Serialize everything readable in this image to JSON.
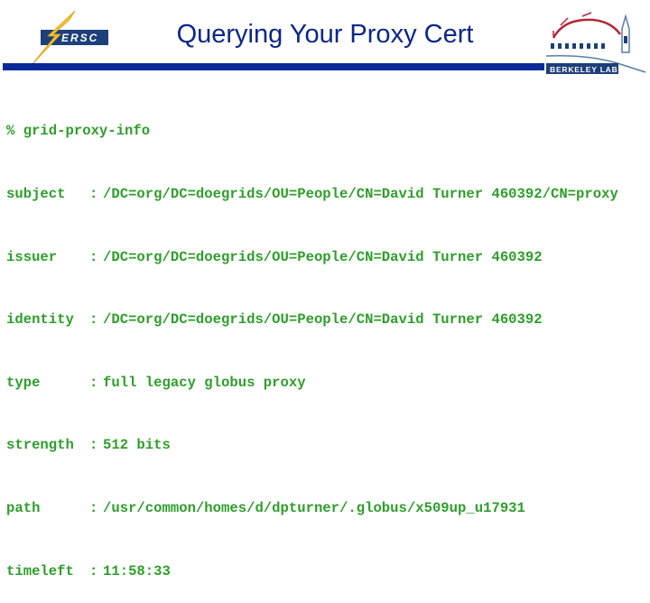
{
  "slide": {
    "title": "Querying Your Proxy Cert",
    "logos": {
      "left": {
        "icon": "nersc-logo-icon",
        "text": "ERSC"
      },
      "right": {
        "icon": "berkeley-lab-logo-icon",
        "text": "BERKELEY LAB"
      }
    },
    "colors": {
      "title": "#0b2788",
      "header_bar": "#0b2a9a",
      "terminal_text": "#2e9e2a",
      "nersc_bolt": "#f2c230",
      "nersc_box": "#1d3f7a"
    }
  },
  "terminal": {
    "command": "% grid-proxy-info",
    "fields": [
      {
        "key": "subject",
        "sep": ":",
        "value": "/DC=org/DC=doegrids/OU=People/CN=David Turner 460392/CN=proxy"
      },
      {
        "key": "issuer",
        "sep": ":",
        "value": "/DC=org/DC=doegrids/OU=People/CN=David Turner 460392"
      },
      {
        "key": "identity",
        "sep": ":",
        "value": "/DC=org/DC=doegrids/OU=People/CN=David Turner 460392"
      },
      {
        "key": "type",
        "sep": ":",
        "value": "full legacy globus proxy"
      },
      {
        "key": "strength",
        "sep": ":",
        "value": "512 bits"
      },
      {
        "key": "path",
        "sep": ":",
        "value": "/usr/common/homes/d/dpturner/.globus/x509up_u17931"
      },
      {
        "key": "timeleft",
        "sep": ":",
        "value": "11:58:33"
      }
    ]
  }
}
